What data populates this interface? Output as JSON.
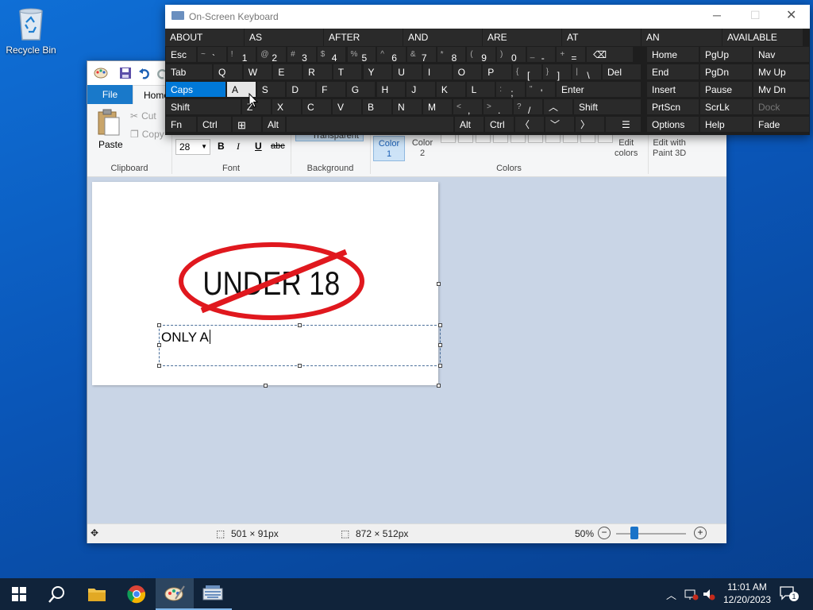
{
  "desktop": {
    "recycle_bin_label": "Recycle Bin"
  },
  "paint": {
    "tabs": {
      "file": "File",
      "home": "Home"
    },
    "clipboard": {
      "paste": "Paste",
      "cut": "Cut",
      "copy": "Copy",
      "group": "Clipboard"
    },
    "font": {
      "size": "28",
      "bold": "B",
      "italic": "I",
      "underline": "U",
      "strike": "abc",
      "group": "Font"
    },
    "background": {
      "transparent": "Transparent",
      "group": "Background"
    },
    "colors": {
      "color1": "Color",
      "color1_num": "1",
      "color2": "Color",
      "color2_num": "2",
      "edit_colors_1": "Edit",
      "edit_colors_2": "colors",
      "group": "Colors"
    },
    "paint3d": {
      "line1": "Edit with",
      "line2": "Paint 3D"
    },
    "canvas": {
      "stamp_text": "UNDER 18",
      "typed_text": "ONLY A"
    },
    "status": {
      "selection_size": "501 × 91px",
      "image_size": "872 × 512px",
      "zoom": "50%"
    }
  },
  "osk": {
    "title": "On-Screen Keyboard",
    "predictions": [
      "ABOUT",
      "AS",
      "AFTER",
      "AND",
      "ARE",
      "AT",
      "AN",
      "AVAILABLE"
    ],
    "row1": [
      {
        "top": "",
        "main": "Esc"
      },
      {
        "top": "~",
        "main": "`"
      },
      {
        "top": "!",
        "main": "1"
      },
      {
        "top": "@",
        "main": "2"
      },
      {
        "top": "#",
        "main": "3"
      },
      {
        "top": "$",
        "main": "4"
      },
      {
        "top": "%",
        "main": "5"
      },
      {
        "top": "^",
        "main": "6"
      },
      {
        "top": "&",
        "main": "7"
      },
      {
        "top": "*",
        "main": "8"
      },
      {
        "top": "(",
        "main": "9"
      },
      {
        "top": ")",
        "main": "0"
      },
      {
        "top": "_",
        "main": "-"
      },
      {
        "top": "+",
        "main": "="
      }
    ],
    "row2": [
      "Tab",
      "Q",
      "W",
      "E",
      "R",
      "T",
      "Y",
      "U",
      "I",
      "O",
      "P",
      "[",
      "]",
      "\\",
      "Del"
    ],
    "row2_tops": {
      "11": "{",
      "12": "}",
      "13": "|"
    },
    "row3": [
      "Caps",
      "A",
      "S",
      "D",
      "F",
      "G",
      "H",
      "J",
      "K",
      "L",
      ";",
      "'",
      "Enter"
    ],
    "row3_tops": {
      "10": ":",
      "11": "\""
    },
    "row4": [
      "Shift",
      "Z",
      "X",
      "C",
      "V",
      "B",
      "N",
      "M",
      ",",
      ".",
      "/",
      "",
      "Shift"
    ],
    "row4_tops": {
      "8": "<",
      "9": ">",
      "10": "?"
    },
    "row5": [
      "Fn",
      "Ctrl",
      "",
      "Alt",
      "Alt",
      "Ctrl"
    ],
    "nav": [
      [
        "Home",
        "PgUp",
        "Nav"
      ],
      [
        "End",
        "PgDn",
        "Mv Up"
      ],
      [
        "Insert",
        "Pause",
        "Mv Dn"
      ],
      [
        "PrtScn",
        "ScrLk",
        "Dock"
      ],
      [
        "Options",
        "Help",
        "Fade"
      ]
    ]
  },
  "taskbar": {
    "time": "11:01 AM",
    "date": "12/20/2023",
    "notifications": "1"
  }
}
